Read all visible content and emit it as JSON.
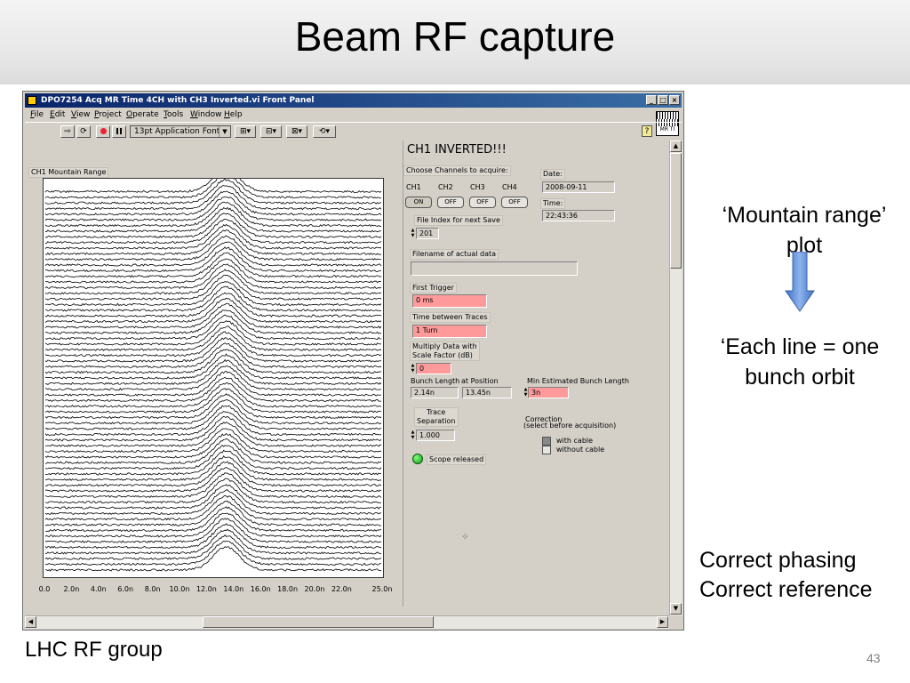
{
  "slide": {
    "title": "Beam RF capture",
    "annotations": {
      "mountain_range": "‘Mountain range’ plot",
      "each_line": "‘Each line = one bunch orbit",
      "correct_phasing": "Correct phasing",
      "correct_reference": "Correct reference"
    },
    "footer": "LHC RF group",
    "page_number": "43"
  },
  "window": {
    "title": "DPO7254 Acq MR Time 4CH with CH3 Inverted.vi Front Panel",
    "controls": {
      "minimize": "_",
      "maximize": "□",
      "close": "×"
    },
    "menu": [
      "File",
      "Edit",
      "View",
      "Project",
      "Operate",
      "Tools",
      "Window",
      "Help"
    ],
    "toolbar": {
      "font_select": "13pt Application Font",
      "icons": [
        "run-arrow-icon",
        "run-continuous-icon",
        "abort-icon",
        "pause-icon",
        "align-icon",
        "distribute-icon",
        "resize-icon",
        "reorder-icon"
      ]
    },
    "vi_icon_text": "MR TI",
    "help_icon": "?"
  },
  "panel": {
    "header": "CH1 INVERTED!!!",
    "chart_label": "CH1 Mountain Range",
    "choose_channels_label": "Choose Channels to acquire:",
    "channels": [
      {
        "name": "CH1",
        "state": "ON"
      },
      {
        "name": "CH2",
        "state": "OFF"
      },
      {
        "name": "CH3",
        "state": "OFF"
      },
      {
        "name": "CH4",
        "state": "OFF"
      }
    ],
    "date_label": "Date:",
    "date_value": "2008-09-11",
    "time_label": "Time:",
    "time_value": "22:43:36",
    "file_index_label": "File Index for next Save",
    "file_index_value": "201",
    "filename_label": "Filename of actual data",
    "filename_value": "",
    "first_trigger_label": "First Trigger",
    "first_trigger_value": "0 ms",
    "time_between_label": "Time between Traces",
    "time_between_value": "1 Turn",
    "multiply_label_1": "Multiply Data with",
    "multiply_label_2": "Scale Factor (dB)",
    "multiply_value": "0",
    "bunch_length_label": "Bunch Length",
    "bunch_length_value": "2.14n",
    "at_position_label": "at Position",
    "at_position_value": "13.45n",
    "min_bunch_label": "Min Estimated Bunch Length",
    "min_bunch_value": "3n",
    "trace_sep_label_1": "Trace",
    "trace_sep_label_2": "Separation",
    "trace_sep_value": "1.000",
    "correction_label_1": "Correction",
    "correction_label_2": "(select before acquisition)",
    "correction_options": [
      "with cable",
      "without cable"
    ],
    "scope_status": "Scope released",
    "status_color": "#22aa22"
  },
  "chart_data": {
    "type": "line",
    "title": "CH1 Mountain Range",
    "xlabel": "",
    "ylabel": "",
    "x_ticks": [
      "0.0",
      "2.0n",
      "4.0n",
      "6.0n",
      "8.0n",
      "10.0n",
      "12.0n",
      "14.0n",
      "16.0n",
      "18.0n",
      "20.0n",
      "22.0n",
      "25.0n"
    ],
    "xlim": [
      0,
      25
    ],
    "x_unit": "ns",
    "trace_count": 68,
    "peak_position_ns": 13.45,
    "peak_width_ns": 2.14,
    "grid": false,
    "legend": "none"
  }
}
